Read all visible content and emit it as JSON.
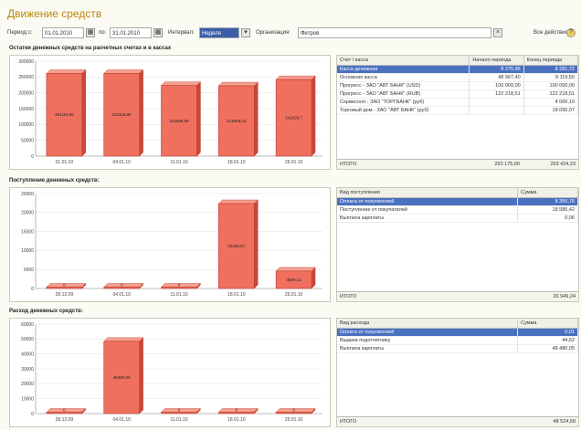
{
  "title": "Движение средств",
  "filter": {
    "period_label": "Период с:",
    "date_from": "01.01.2010",
    "to_label": "по:",
    "date_to": "31.01.2010",
    "interval_label": "Интервал:",
    "interval_value": "Неделя",
    "org_label": "Организация:",
    "org_value": "Фетров",
    "actions_label": "Все действия"
  },
  "sections": [
    {
      "title": "Остатки денежных средств на расчетных счетах и в кассах",
      "table": {
        "headers": [
          "Счет / касса",
          "Начало периода",
          "Конец периода"
        ],
        "rows": [
          [
            "Касса денежная",
            "8 275,95",
            "8 281,72"
          ],
          [
            "Основная касса",
            "48 967,40",
            "8 119,50"
          ],
          [
            "Прогресс - ЗАО \"АВТ БАНК\" (USD)",
            "100 000,00",
            "100 000,00"
          ],
          [
            "Прогресс - ЗАО \"АВТ БАНК\" (RUB)",
            "122 218,51",
            "122 218,51"
          ],
          [
            "Сервисолл - ЗАО \"ТОРГБАНК\" (руб)",
            "",
            "4 000,10"
          ],
          [
            "Торговый дом - ЗАО \"АВТ БАНК\" (руб)",
            "",
            "18 095,07"
          ]
        ],
        "selected_row": 0,
        "total_label": "ИТОГО",
        "total_values": [
          "293 175,00",
          "293 424,23"
        ]
      },
      "chart_data": {
        "type": "bar",
        "categories": [
          "01.01.10",
          "04.01.10",
          "11.01.10",
          "18.01.10",
          "25.01.10"
        ],
        "values": [
          261119.86,
          261119.86,
          223058.88,
          221908.04,
          241926.7
        ],
        "data_labels": [
          "261119,86",
          "261119,86",
          "223058,88",
          "221908,04",
          "241926,7"
        ],
        "ylim": [
          0,
          300000
        ],
        "yticks": [
          "300000",
          "250000",
          "200000",
          "150000",
          "100000",
          "50000",
          "0"
        ],
        "yticks_values": [
          300000,
          250000,
          200000,
          150000,
          100000,
          50000,
          0
        ],
        "style": "3d"
      }
    },
    {
      "title": "Поступление денежных средств:",
      "table": {
        "headers": [
          "Вид поступления",
          "Сумма"
        ],
        "rows": [
          [
            "Оплата от покупателей",
            "8 355,76"
          ],
          [
            "Поступление от покупателей",
            "18 585,42"
          ],
          [
            "Выплата зарплаты",
            "0,06"
          ]
        ],
        "selected_row": 0,
        "total_label": "ИТОГО",
        "total_values": [
          "26 949,24"
        ]
      },
      "chart_data": {
        "type": "bar",
        "categories": [
          "28.12.09",
          "04.01.10",
          "11.01.10",
          "18.01.10",
          "25.01.10"
        ],
        "values": [
          0,
          0,
          0,
          22358.57,
          4590.12
        ],
        "data_labels": [
          "0",
          "0",
          "0",
          "22358,57",
          "4590,12"
        ],
        "ylim": [
          0,
          25000
        ],
        "yticks": [
          "25000",
          "20000",
          "15000",
          "10000",
          "5000",
          "0"
        ],
        "yticks_values": [
          25000,
          20000,
          15000,
          10000,
          5000,
          0
        ],
        "style": "3d"
      }
    },
    {
      "title": "Расход денежных средств:",
      "table": {
        "headers": [
          "Вид расхода",
          "Сумма"
        ],
        "rows": [
          [
            "Оплата от покупателей",
            "0,01"
          ],
          [
            "Выдача подотчетнику",
            "44,62"
          ],
          [
            "Выплата зарплаты",
            "48 480,05"
          ]
        ],
        "selected_row": 0,
        "total_label": "ИТОГО",
        "total_values": [
          "48 524,68"
        ]
      },
      "chart_data": {
        "type": "bar",
        "categories": [
          "28.12.09",
          "04.01.10",
          "11.01.10",
          "18.01.10",
          "25.01.10"
        ],
        "values": [
          0,
          48480.05,
          0,
          0,
          0
        ],
        "data_labels": [
          "0",
          "48480,05",
          "0",
          "0",
          "0"
        ],
        "ylim": [
          0,
          60000
        ],
        "yticks": [
          "60000",
          "50000",
          "40000",
          "30000",
          "20000",
          "10000",
          "0"
        ],
        "yticks_values": [
          60000,
          50000,
          40000,
          30000,
          20000,
          10000,
          0
        ],
        "style": "3d"
      }
    }
  ]
}
